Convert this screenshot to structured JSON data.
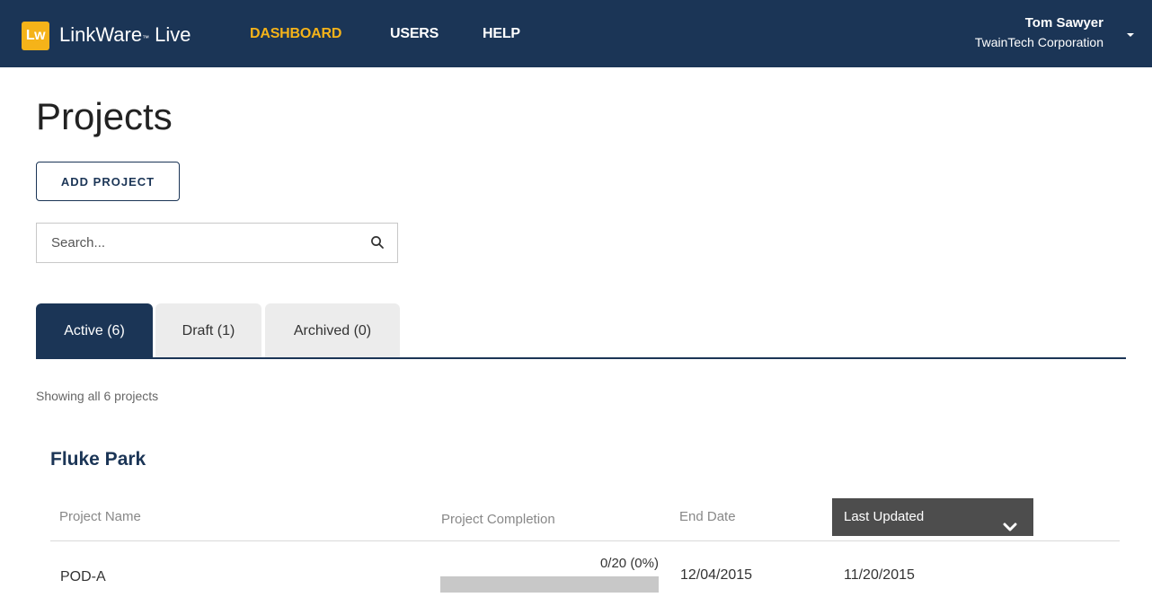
{
  "header": {
    "logo_text": "Lw",
    "app_name": "LinkWare",
    "app_tm": "™",
    "app_suffix": "Live",
    "nav": [
      {
        "label": "DASHBOARD",
        "active": true
      },
      {
        "label": "USERS",
        "active": false
      },
      {
        "label": "HELP",
        "active": false
      }
    ],
    "user_name": "Tom Sawyer",
    "user_org": "TwainTech Corporation",
    "user_caret_icon": "caret-down-icon"
  },
  "page": {
    "title": "Projects",
    "add_button_label": "ADD PROJECT",
    "search_placeholder": "Search...",
    "search_icon": "search-icon"
  },
  "tabs": [
    {
      "label": "Active (6)",
      "active": true
    },
    {
      "label": "Draft (1)",
      "active": false
    },
    {
      "label": "Archived (0)",
      "active": false
    }
  ],
  "status_text": "Showing all 6 projects",
  "group": {
    "title": "Fluke Park",
    "columns": {
      "name": "Project Name",
      "completion": "Project Completion",
      "end_date": "End Date",
      "last_updated": "Last Updated"
    },
    "sort_icon": "chevron-down-icon",
    "rows": [
      {
        "name": "POD-A",
        "completion_text": "0/20 (0%)",
        "completion_fraction": 0,
        "end_date": "12/04/2015",
        "last_updated": "11/20/2015"
      }
    ]
  },
  "colors": {
    "brand_navy": "#1b3556",
    "accent_yellow": "#f5b319",
    "sorted_header_bg": "#4d4d4d",
    "progress_track": "#c8c8c8"
  }
}
